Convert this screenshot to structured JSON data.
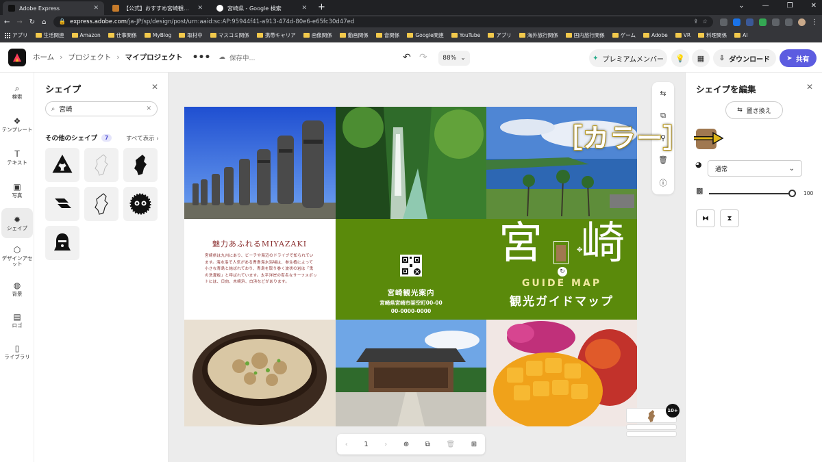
{
  "browser": {
    "tabs": [
      {
        "title": "Adobe Express",
        "active": true
      },
      {
        "title": "【公式】おすすめ宮崎観光スポット/…",
        "active": false
      },
      {
        "title": "宮崎県 - Google 検索",
        "active": false
      }
    ],
    "new_tab": "+",
    "url_domain": "express.adobe.com",
    "url_path": "/ja-JP/sp/design/post/urn:aaid:sc:AP:95944f41-a913-474d-80e6-e65fc30d47ed",
    "bookmarks": [
      "アプリ",
      "生活関連",
      "Amazon",
      "仕事関係",
      "MyBlog",
      "取材中",
      "マスコミ関係",
      "携帯キャリア",
      "画像関係",
      "動画関係",
      "音関係",
      "Google関連",
      "YouTube",
      "アプリ",
      "海外旅行関係",
      "国内旅行関係",
      "ゲーム",
      "Adobe",
      "VR",
      "料理関係",
      "AI"
    ]
  },
  "header": {
    "breadcrumbs": [
      "ホーム",
      "プロジェクト",
      "マイプロジェクト"
    ],
    "more": "•••",
    "saving": "保存中...",
    "zoom": "88%",
    "premium": "プレミアムメンバー",
    "download": "ダウンロード",
    "share": "共有"
  },
  "rail": [
    {
      "label": "検索",
      "icon": "search-icon"
    },
    {
      "label": "テンプレート",
      "icon": "template-icon"
    },
    {
      "label": "テキスト",
      "icon": "text-icon"
    },
    {
      "label": "写真",
      "icon": "photo-icon"
    },
    {
      "label": "シェイプ",
      "icon": "shape-icon",
      "active": true
    },
    {
      "label": "デザインアセット",
      "icon": "design-asset-icon"
    },
    {
      "label": "背景",
      "icon": "background-icon"
    },
    {
      "label": "ロゴ",
      "icon": "logo-icon"
    },
    {
      "label": "ライブラリ",
      "icon": "library-icon"
    }
  ],
  "shapes_panel": {
    "title": "シェイプ",
    "search_value": "宮崎",
    "others_title": "その他のシェイプ",
    "others_count": "7",
    "see_all": "すべて表示 ›"
  },
  "canvas": {
    "miyazaki_title": "魅力あふれるMIYAZAKI",
    "miyazaki_body": "宮崎県は九州にあり、ビーチや海辺のドライブで知られています。海水浴で人気がある青島海水浴場は、参生植によって小さな青島と結ばれており、青島を取り巻く波状の岩は「鬼の洗濯板」と呼ばれています。太平洋岸の有名なサーフスポットには、日向、木崎浜、白浜などがあります。",
    "guide_name": "宮崎観光案内",
    "guide_addr": "宮崎県宮崎市架空町00-00",
    "guide_tel": "00-0000-0000",
    "kanji_left": "宮",
    "kanji_right": "崎",
    "guide_map": "GUIDE MAP",
    "kanko": "観光ガイドマップ",
    "page_number": "1",
    "thumb_badge": "10+"
  },
  "edit_panel": {
    "title": "シェイプを編集",
    "replace": "置き換え",
    "color": "#a07850",
    "blend_mode": "通常",
    "opacity": "100"
  },
  "annotation": {
    "text": "［カラー］"
  }
}
